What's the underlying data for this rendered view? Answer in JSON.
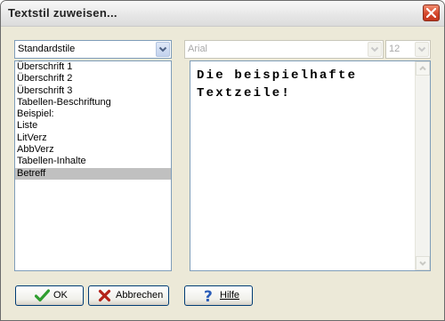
{
  "dialog": {
    "title": "Textstil zuweisen...",
    "close_label": "×"
  },
  "style_category": {
    "selected": "Standardstile"
  },
  "font": {
    "name": "Arial",
    "size": "12"
  },
  "styles_list": {
    "items": [
      "Überschrift 1",
      "Überschrift 2",
      "Überschrift 3",
      "Tabellen-Beschriftung",
      "Beispiel:",
      "Liste",
      "LitVerz",
      "AbbVerz",
      "Tabellen-Inhalte",
      "Betreff"
    ],
    "selected_index": 9
  },
  "preview": {
    "text": "Die beispielhafte Textzeile!"
  },
  "buttons": {
    "ok": "OK",
    "cancel": "Abbrechen",
    "help": "Hilfe"
  },
  "colors": {
    "dialog_face": "#ece9d8",
    "selection": "#c0c0c0",
    "ok_check": "#2f9e2f",
    "cancel_x": "#b4231a",
    "help_q": "#2b5db8"
  },
  "icons": {
    "close": "close-icon",
    "dropdown": "chevron-down-icon",
    "ok": "checkmark-icon",
    "cancel": "x-icon",
    "help": "question-icon"
  }
}
